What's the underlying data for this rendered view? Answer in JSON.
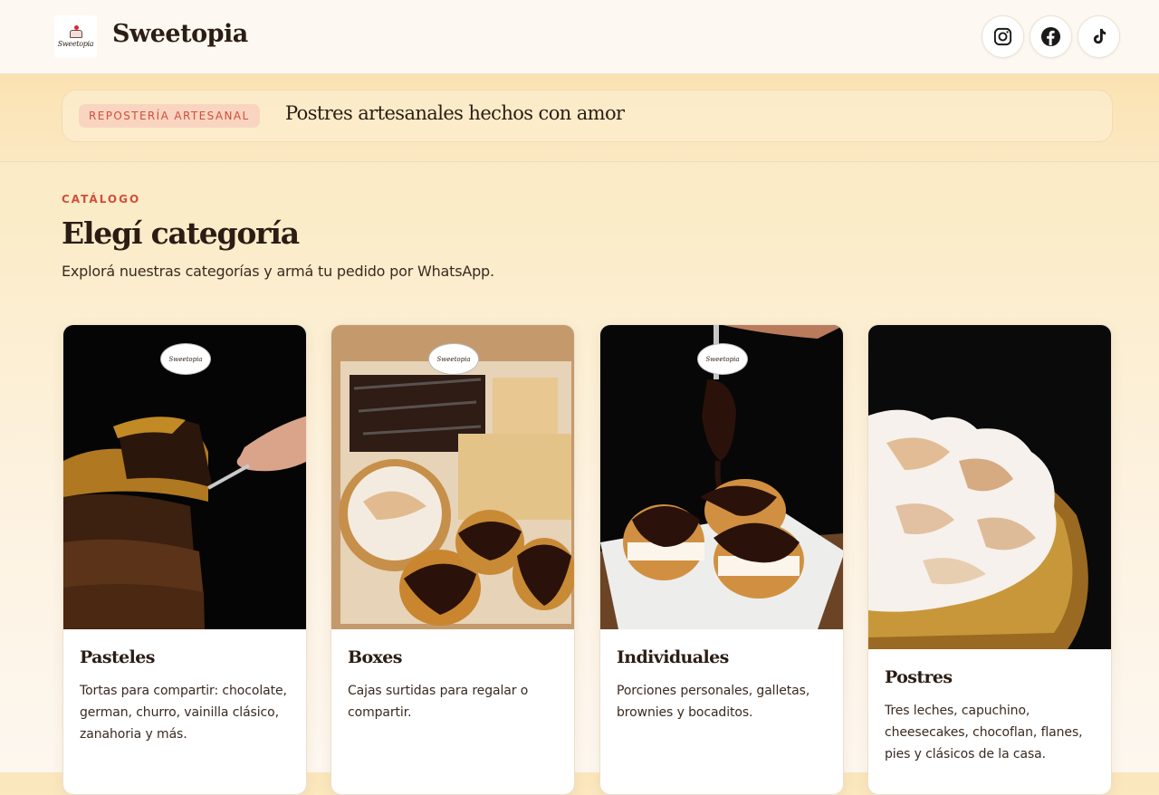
{
  "header": {
    "logo_text": "Sweetopia",
    "brand_name": "Sweetopia",
    "social": [
      {
        "icon": "instagram-icon"
      },
      {
        "icon": "facebook-icon"
      },
      {
        "icon": "tiktok-icon"
      }
    ]
  },
  "banner": {
    "badge": "REPOSTERÍA ARTESANAL",
    "text": "Postres artesanales hechos con amor"
  },
  "catalog": {
    "eyebrow": "CATÁLOGO",
    "title": "Elegí categoría",
    "subtitle": "Explorá nuestras categorías y armá tu pedido por WhatsApp."
  },
  "categories": [
    {
      "title": "Pasteles",
      "description": "Tortas para compartir: chocolate, german, churro, vainilla clásico, zanahoria y más.",
      "watermark": "Sweetopia"
    },
    {
      "title": "Boxes",
      "description": "Cajas surtidas para regalar o compartir.",
      "watermark": "Sweetopia"
    },
    {
      "title": "Individuales",
      "description": "Porciones personales, galletas, brownies y bocaditos.",
      "watermark": "Sweetopia"
    },
    {
      "title": "Postres",
      "description": "Tres leches, capuchino, cheesecakes, chocoflan, flanes, pies y clásicos de la casa.",
      "watermark": ""
    }
  ],
  "colors": {
    "accent": "#d04e3d",
    "badge_bg": "#f9d5c1",
    "text_dark": "#2b1d14",
    "page_bg": "#fbe7bd"
  }
}
